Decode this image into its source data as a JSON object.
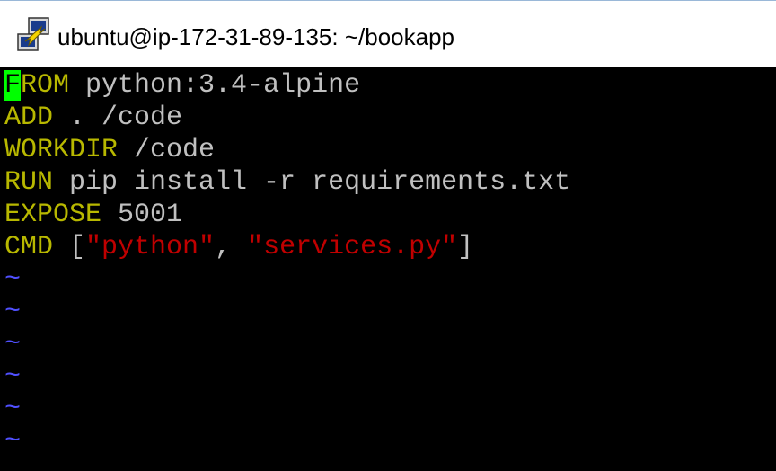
{
  "window": {
    "title": "ubuntu@ip-172-31-89-135: ~/bookapp",
    "icon": "putty-icon"
  },
  "editor": {
    "lines": [
      {
        "cursor_char": "F",
        "kw": "ROM",
        "rest": " python:3.4-alpine"
      },
      {
        "kw": "ADD",
        "rest": " . /code"
      },
      {
        "kw": "WORKDIR",
        "rest": " /code"
      },
      {
        "kw": "RUN",
        "rest": " pip install -r requirements.txt"
      },
      {
        "kw": "EXPOSE",
        "rest": " 5001"
      },
      {
        "kw": "CMD",
        "p1": " [",
        "s1": "\"python\"",
        "p2": ", ",
        "s2": "\"services.py\"",
        "p3": "]"
      }
    ],
    "empty_line_marker": "~"
  },
  "colors": {
    "background": "#000000",
    "keyword": "#b8b800",
    "text": "#c0c0c0",
    "string": "#c00000",
    "cursor": "#00ff00",
    "tilde": "#5050ff"
  }
}
